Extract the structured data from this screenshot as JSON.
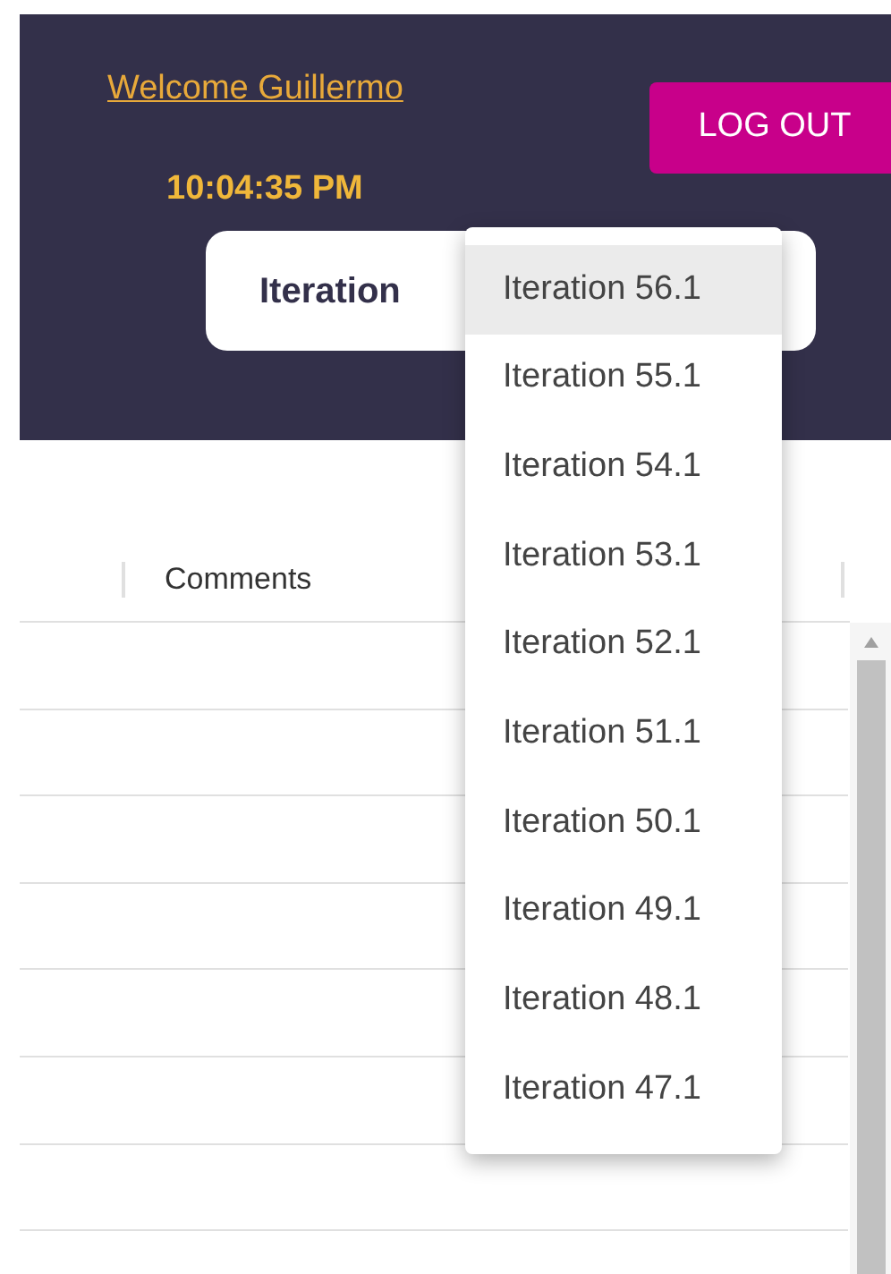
{
  "header": {
    "welcome_link": "Welcome Guillermo",
    "time": "10:04:35 PM",
    "logout_button": "LOG OUT",
    "iteration_select": {
      "label": "Iteration",
      "expanded": true
    }
  },
  "iteration_menu": [
    {
      "label": "Iteration 56.1",
      "selected": true
    },
    {
      "label": "Iteration 55.1",
      "selected": false
    },
    {
      "label": "Iteration 54.1",
      "selected": false
    },
    {
      "label": "Iteration 53.1",
      "selected": false
    },
    {
      "label": "Iteration 52.1",
      "selected": false
    },
    {
      "label": "Iteration 51.1",
      "selected": false
    },
    {
      "label": "Iteration 50.1",
      "selected": false
    },
    {
      "label": "Iteration 49.1",
      "selected": false
    },
    {
      "label": "Iteration 48.1",
      "selected": false
    },
    {
      "label": "Iteration 47.1",
      "selected": false
    }
  ],
  "table": {
    "columns": [
      "Comments"
    ]
  }
}
